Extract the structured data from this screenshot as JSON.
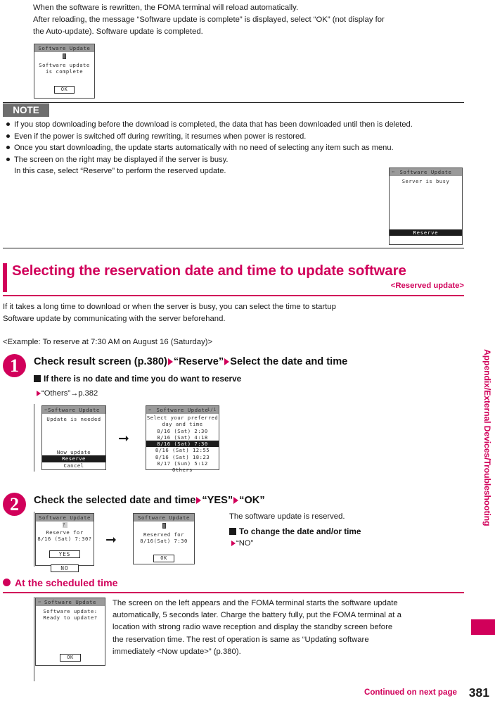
{
  "intro": {
    "line1": "When the software is rewritten, the FOMA terminal will reload automatically.",
    "line2": "After reloading, the message “Software update is complete” is displayed, select “OK” (not display for",
    "line3": "the Auto-update). Software update is completed."
  },
  "screen_complete": {
    "title": "Software Update",
    "line1": "Software update",
    "line2": "is complete",
    "button": "OK"
  },
  "note": {
    "badge": "NOTE",
    "items": [
      "If you stop downloading before the download is completed, the data that has been downloaded until then is deleted.",
      "Even if the power is switched off during rewriting, it resumes when power is restored.",
      "Once you start downloading, the update starts automatically with no need of selecting any item such as menu.",
      "The screen on the right may be displayed if the server is busy."
    ],
    "sub_line": "In this case, select “Reserve” to perform the reserved update."
  },
  "screen_busy": {
    "title": "Software Update",
    "back_icon": "back-arrow-icon",
    "line1": "Server is busy",
    "softkey": "Reserve"
  },
  "section": {
    "title": "Selecting the reservation date and time to update software",
    "subtitle": "<Reserved update>",
    "accent_color": "#d1005a"
  },
  "paragraph": {
    "line1": "If it takes a long time to download or when the server is busy, you can select the time to startup",
    "line2": "Software update by communicating with the server beforehand.",
    "example": "<Example: To reserve at 7:30 AM on August 16 (Saturday)>"
  },
  "step1": {
    "number": "1",
    "head_a": "Check result screen (p.380)",
    "head_b": "“Reserve”",
    "head_c": "Select the date and time",
    "sub_head": "If there is no date and time you do want to reserve",
    "sub_line": "“Others”→p.382",
    "arrow": "➡"
  },
  "screen_update_needed": {
    "title": "Software Update",
    "back_icon": "back-arrow-icon",
    "line1": "Update is needed",
    "option1": "Now update",
    "option2": "Reserve",
    "option3": "Cancel"
  },
  "screen_select_time": {
    "title": "Software Update",
    "back_icon": "back-arrow-icon",
    "page_indicator": "1/1",
    "prompt1": "Select your preferred",
    "prompt2": "day and time",
    "options": [
      "8/16 (Sat)  2:30",
      "8/16 (Sat)  4:18",
      "8/16 (Sat)  7:30",
      "8/16 (Sat) 12:55",
      "8/16 (Sat) 18:23",
      "8/17 (Sun)  5:12",
      "Others"
    ],
    "selected_index": 2
  },
  "step2": {
    "number": "2",
    "head_a": "Check the selected date and time",
    "head_b": "“YES”",
    "head_c": "“OK”",
    "note_line": "The software update is reserved.",
    "sub_head": "To change the date and/or time",
    "sub_line": "“NO”",
    "arrow": "➡"
  },
  "screen_reserve_confirm": {
    "title": "Software Update",
    "icon": "question-icon",
    "line1": "Reserve for",
    "line2": "8/16 (Sat)  7:30?",
    "button_yes": "YES",
    "button_no": "NO"
  },
  "screen_reserved": {
    "title": "Software Update",
    "icon": "info-icon",
    "line1": "Reserved for",
    "line2": "8/16(Sat)  7:30",
    "button": "OK"
  },
  "scheduled": {
    "heading": "At the scheduled time",
    "body1": "The screen on the left appears and the FOMA terminal starts the software update",
    "body2": "automatically, 5 seconds later. Charge the battery fully, put the FOMA terminal at a",
    "body3": "location with strong radio wave reception and display the standby screen before",
    "body4": "the reservation time. The rest of operation is same as “Updating software",
    "body5": "immediately <Now update>” (p.380)."
  },
  "screen_ready": {
    "title": "Software Update",
    "back_icon": "back-arrow-icon",
    "line1": "Software update:",
    "line2": "Ready to update?",
    "button": "OK"
  },
  "side_tab": {
    "label": "Appendix/External Devices/Troubleshooting"
  },
  "footer": {
    "continued": "Continued on next page",
    "page_number": "381"
  }
}
